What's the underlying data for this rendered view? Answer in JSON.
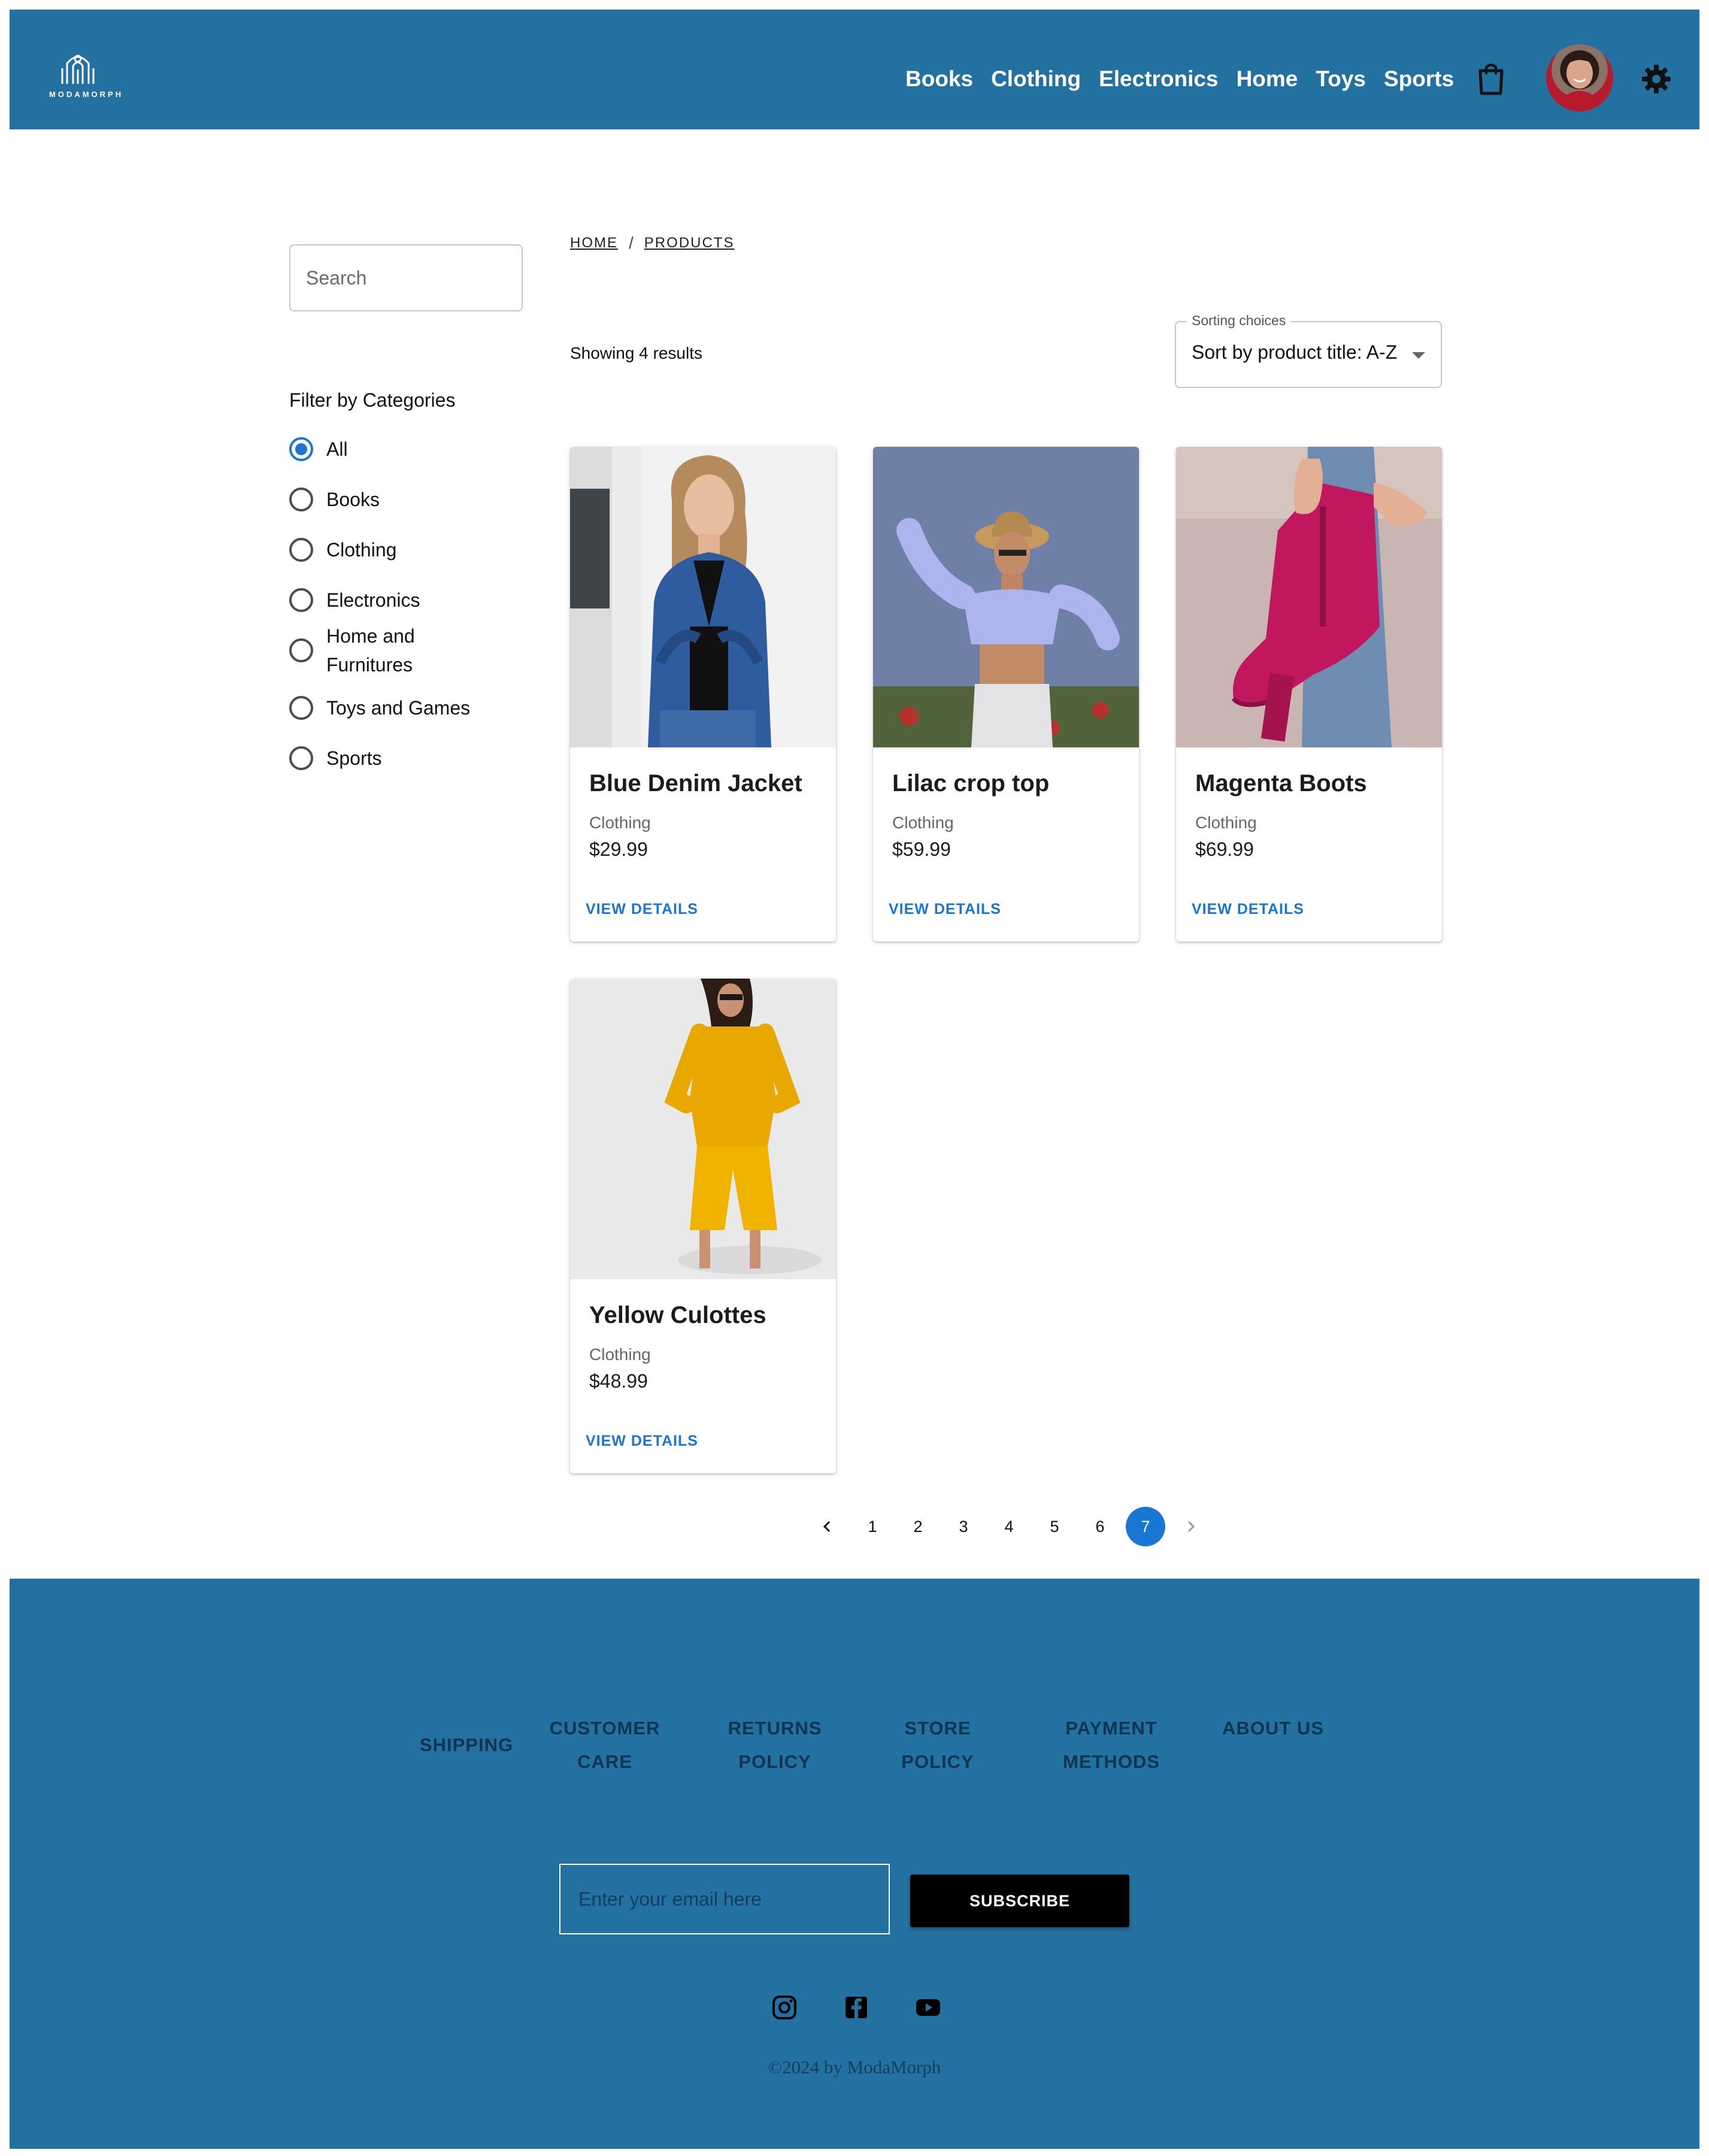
{
  "brand": {
    "logo_text": "MODAMORPH",
    "accent": "#2371a0",
    "primary": "#1976d2"
  },
  "header": {
    "nav": [
      "Books",
      "Clothing",
      "Electronics",
      "Home",
      "Toys",
      "Sports"
    ],
    "icons": [
      "shopping-bag-icon",
      "avatar",
      "settings-icon"
    ]
  },
  "sidebar": {
    "search_placeholder": "Search",
    "filter_title": "Filter by Categories",
    "categories": [
      {
        "label": "All",
        "checked": true
      },
      {
        "label": "Books",
        "checked": false
      },
      {
        "label": "Clothing",
        "checked": false
      },
      {
        "label": "Electronics",
        "checked": false
      },
      {
        "label": "Home and Furnitures",
        "checked": false
      },
      {
        "label": "Toys and Games",
        "checked": false
      },
      {
        "label": "Sports",
        "checked": false
      }
    ]
  },
  "main": {
    "breadcrumb": [
      "HOME",
      "PRODUCTS"
    ],
    "breadcrumb_sep": "/",
    "results": "Showing 4 results",
    "sort": {
      "label": "Sorting choices",
      "value": "Sort by product title: A-Z"
    },
    "products": [
      {
        "title": "Blue Denim Jacket",
        "category": "Clothing",
        "price": "$29.99",
        "link": "VIEW DETAILS"
      },
      {
        "title": "Lilac crop top",
        "category": "Clothing",
        "price": "$59.99",
        "link": "VIEW DETAILS"
      },
      {
        "title": "Magenta Boots",
        "category": "Clothing",
        "price": "$69.99",
        "link": "VIEW DETAILS"
      },
      {
        "title": "Yellow Culottes",
        "category": "Clothing",
        "price": "$48.99",
        "link": "VIEW DETAILS"
      }
    ],
    "pagination": {
      "pages": [
        "1",
        "2",
        "3",
        "4",
        "5",
        "6",
        "7"
      ],
      "current": "7"
    }
  },
  "footer": {
    "links": [
      "SHIPPING",
      "CUSTOMER CARE",
      "RETURNS POLICY",
      "STORE POLICY",
      "PAYMENT METHODS",
      "ABOUT US"
    ],
    "email_placeholder": "Enter your email here",
    "subscribe": "SUBSCRIBE",
    "social": [
      "instagram-icon",
      "facebook-icon",
      "youtube-icon"
    ],
    "copyright": "©2024 by ModaMorph"
  }
}
